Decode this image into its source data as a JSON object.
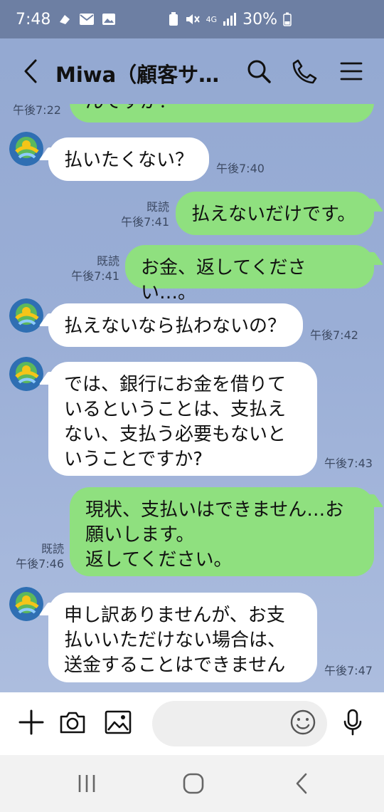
{
  "status_bar": {
    "time": "7:48",
    "network": "4G",
    "battery": "30%"
  },
  "header": {
    "title": "Miwa（顧客サ…"
  },
  "messages": [
    {
      "from": "out",
      "text": "んですか？",
      "read": "",
      "time": "午後7:22"
    },
    {
      "from": "in",
      "text": "払いたくない？",
      "time": "午後7:40"
    },
    {
      "from": "out",
      "text": "払えないだけです。",
      "read": "既読",
      "time": "午後7:41"
    },
    {
      "from": "out",
      "text": "お金、返してください…。",
      "read": "既読",
      "time": "午後7:41"
    },
    {
      "from": "in",
      "text": "払えないなら払わないの？",
      "time": "午後7:42"
    },
    {
      "from": "in",
      "lines": [
        "では、銀行にお金を借りて",
        "いるということは、支払え",
        "ない、支払う必要もないと",
        "いうことですか?"
      ],
      "time": "午後7:43"
    },
    {
      "from": "out",
      "lines": [
        "現状、支払いはできません…お",
        "願いします。",
        "返してください。"
      ],
      "read": "既読",
      "time": "午後7:46"
    },
    {
      "from": "in",
      "lines": [
        "申し訳ありませんが、お支",
        "払いいただけない場合は、",
        "送金することはできません"
      ],
      "time": "午後7:47"
    }
  ],
  "input_bar": {
    "placeholder": ""
  },
  "colors": {
    "background": "#9aaed6",
    "outgoing_bubble": "#8fe07f",
    "incoming_bubble": "#ffffff"
  },
  "icons": [
    "back-icon",
    "search-icon",
    "phone-icon",
    "menu-icon",
    "plus-icon",
    "camera-icon",
    "image-icon",
    "emoji-icon",
    "mic-icon",
    "recent-apps-icon",
    "home-icon",
    "nav-back-icon"
  ]
}
